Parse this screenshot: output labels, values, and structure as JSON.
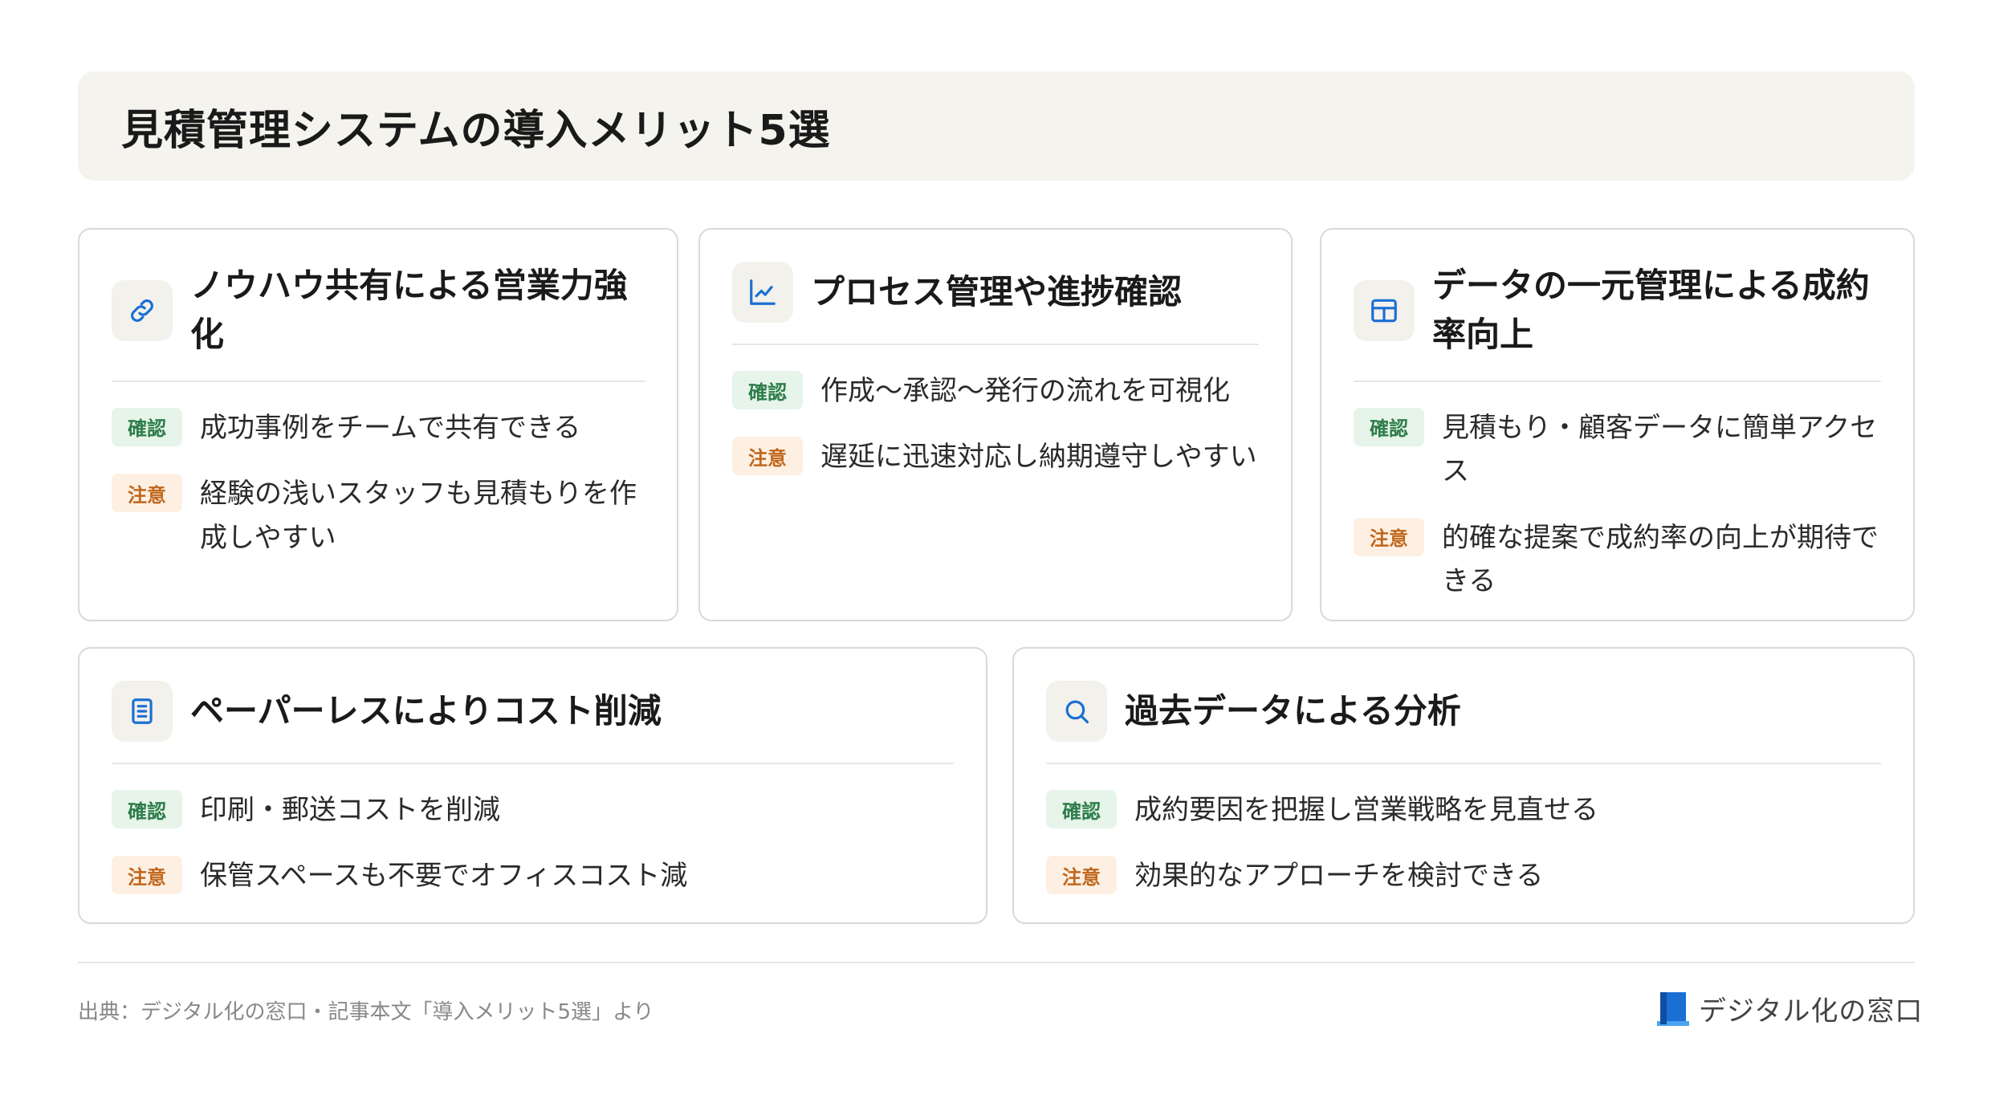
{
  "title": "見積管理システムの導入メリット5選",
  "badges": {
    "ok": "確認",
    "warn": "注意"
  },
  "cards": [
    {
      "title": "ノウハウ共有による営業力強化",
      "icon": "link-icon",
      "confirm": "成功事例をチームで共有できる",
      "caution": "経験の浅いスタッフも見積もりを作成しやすい"
    },
    {
      "title": "プロセス管理や進捗確認",
      "icon": "chart-line-icon",
      "confirm": "作成〜承認〜発行の流れを可視化",
      "caution": "遅延に迅速対応し納期遵守しやすい"
    },
    {
      "title": "データの一元管理による成約率向上",
      "icon": "table-icon",
      "confirm": "見積もり・顧客データに簡単アクセス",
      "caution": "的確な提案で成約率の向上が期待できる"
    },
    {
      "title": "ペーパーレスによりコスト削減",
      "icon": "document-icon",
      "confirm": "印刷・郵送コストを削減",
      "caution": "保管スペースも不要でオフィスコスト減"
    },
    {
      "title": "過去データによる分析",
      "icon": "search-icon",
      "confirm": "成約要因を把握し営業戦略を見直せる",
      "caution": "効果的なアプローチを検討できる"
    }
  ],
  "footer": {
    "source": "出典：デジタル化の窓口・記事本文「導入メリット5選」より",
    "logo_text": "デジタル化の窓口"
  },
  "colors": {
    "accent": "#1a6fd4",
    "ok_text": "#2e7d4a",
    "ok_bg": "#e6f4ea",
    "warn_text": "#c0661c",
    "warn_bg": "#fdf0e2",
    "title_bg": "#f5f3ee"
  }
}
